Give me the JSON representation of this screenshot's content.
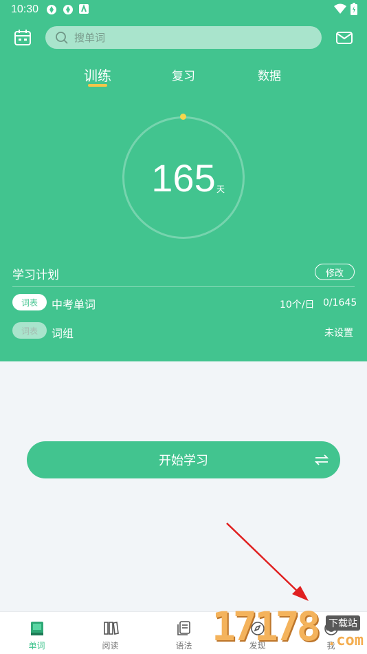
{
  "status_bar": {
    "time": "10:30"
  },
  "header": {
    "search_placeholder": "搜单词"
  },
  "tabs": [
    {
      "label": "训练",
      "active": true
    },
    {
      "label": "复习",
      "active": false
    },
    {
      "label": "数据",
      "active": false
    }
  ],
  "progress": {
    "days": "165",
    "unit": "天"
  },
  "plan": {
    "title": "学习计划",
    "edit_label": "修改",
    "books": [
      {
        "badge": "词表",
        "name": "中考单词",
        "per_day": "10个/日",
        "progress": "0/1645",
        "active": true
      },
      {
        "badge": "词表",
        "name": "词组",
        "status": "未设置",
        "active": false
      }
    ]
  },
  "start_button": {
    "label": "开始学习"
  },
  "bottom_nav": [
    {
      "label": "单词",
      "icon": "book-icon",
      "active": true
    },
    {
      "label": "阅读",
      "icon": "books-icon",
      "active": false
    },
    {
      "label": "语法",
      "icon": "grammar-icon",
      "active": false
    },
    {
      "label": "发现",
      "icon": "discover-icon",
      "active": false
    },
    {
      "label": "我",
      "icon": "profile-icon",
      "active": false
    }
  ],
  "watermark": {
    "big": "17178",
    "small": "下载站",
    "com": ".com"
  },
  "colors": {
    "brand": "#42c48f",
    "accent": "#f3c64a",
    "annotation": "#e02020"
  }
}
